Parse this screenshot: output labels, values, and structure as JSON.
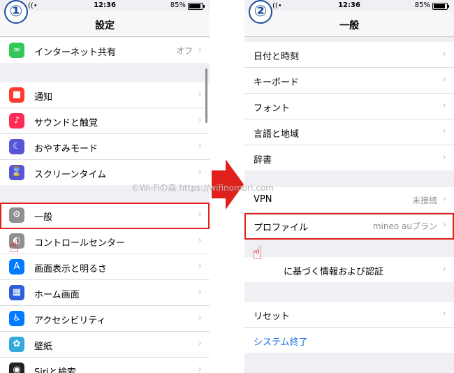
{
  "phone1": {
    "status": {
      "time": "12:36",
      "battery": "85%"
    },
    "step": "①",
    "title": "設定",
    "rows_top": [
      {
        "label": "インターネット共有",
        "value": "オフ",
        "icon": "link-icon",
        "color": "#34c759"
      }
    ],
    "rows_mid": [
      {
        "label": "通知",
        "icon": "notification-icon",
        "color": "#ff3b30"
      },
      {
        "label": "サウンドと触覚",
        "icon": "speaker-icon",
        "color": "#ff2d55"
      },
      {
        "label": "おやすみモード",
        "icon": "moon-icon",
        "color": "#5856d6"
      },
      {
        "label": "スクリーンタイム",
        "icon": "hourglass-icon",
        "color": "#5856d6"
      }
    ],
    "rows_bottom": [
      {
        "label": "一般",
        "icon": "gear-icon",
        "color": "#8e8e93"
      },
      {
        "label": "コントロールセンター",
        "icon": "toggle-icon",
        "color": "#8e8e93"
      },
      {
        "label": "画面表示と明るさ",
        "icon": "brightness-icon",
        "color": "#007aff"
      },
      {
        "label": "ホーム画面",
        "icon": "grid-icon",
        "color": "#2c5fd9"
      },
      {
        "label": "アクセシビリティ",
        "icon": "accessibility-icon",
        "color": "#007aff"
      },
      {
        "label": "壁紙",
        "icon": "flower-icon",
        "color": "#34aadc"
      },
      {
        "label": "Siriと検索",
        "icon": "siri-icon",
        "color": "#222222"
      }
    ]
  },
  "phone2": {
    "status": {
      "time": "12:36",
      "battery": "85%"
    },
    "step": "②",
    "title": "一般",
    "rows_a": [
      {
        "label": "日付と時刻"
      },
      {
        "label": "キーボード"
      },
      {
        "label": "フォント"
      },
      {
        "label": "言語と地域"
      },
      {
        "label": "辞書"
      }
    ],
    "rows_b": [
      {
        "label": "VPN",
        "value": "未接続"
      },
      {
        "label": "プロファイル",
        "value": "mineo auプラン"
      }
    ],
    "rows_c": [
      {
        "label": "に基づく情報および認証"
      }
    ],
    "rows_d": [
      {
        "label": "リセット"
      },
      {
        "label": "システム終了"
      }
    ]
  },
  "watermark": "©Wi-Fiの森 https://wifinomori.com",
  "colors": {
    "highlight": "#e0201a",
    "link": "#1a73e8",
    "step": "#1e4d9c"
  }
}
